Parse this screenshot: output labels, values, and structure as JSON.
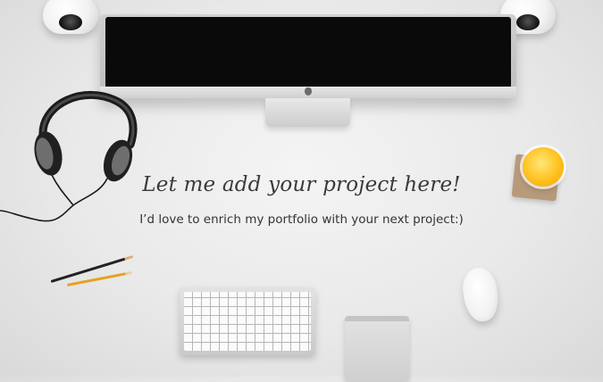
{
  "hero": {
    "headline": "Let me add your project here!",
    "subline": "I’d love to enrich my portfolio with your next project:)"
  },
  "colors": {
    "background": "#ededed",
    "text": "#333333",
    "screen": "#0a0a0a",
    "juice": "#ffc11d"
  },
  "icons": {
    "speaker_left": "speaker-icon",
    "speaker_right": "speaker-icon",
    "monitor": "imac-icon",
    "headphones": "headphones-icon",
    "juice": "juice-glass-icon",
    "keyboard": "keyboard-icon",
    "trackpad": "trackpad-icon",
    "mouse": "mouse-icon",
    "pencils": "pencil-icon"
  }
}
